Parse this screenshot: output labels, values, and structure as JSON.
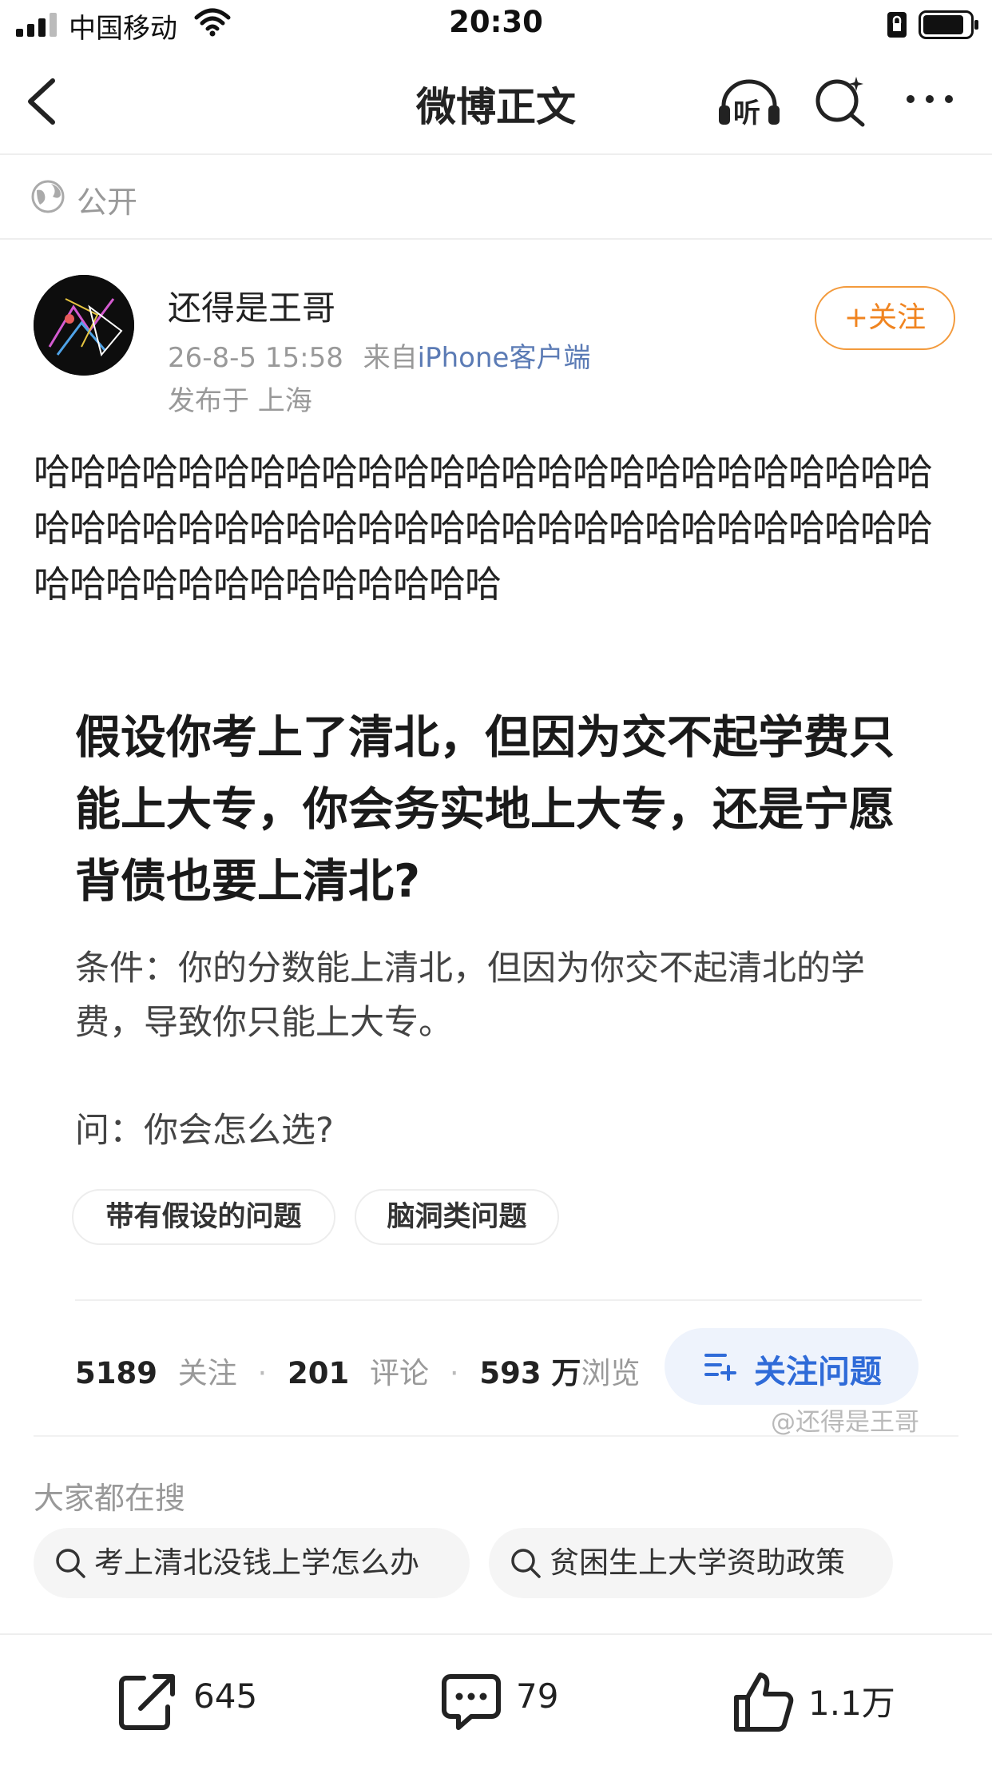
{
  "status_bar": {
    "carrier": "中国移动",
    "time": "20:30"
  },
  "nav": {
    "title": "微博正文",
    "listen_label": "听"
  },
  "visibility": {
    "label": "公开"
  },
  "post": {
    "username": "还得是王哥",
    "timestamp": "26-8-5 15:58",
    "source_prefix": "来自",
    "source": "iPhone客户端",
    "location": "发布于 上海",
    "follow_label": "+关注",
    "body": "哈哈哈哈哈哈哈哈哈哈哈哈哈哈哈哈哈哈哈哈哈哈哈哈哈哈哈哈哈哈哈哈哈哈哈哈哈哈哈哈哈哈哈哈哈哈哈哈哈哈哈哈哈哈哈哈哈哈哈哈哈哈哈"
  },
  "question": {
    "title": "假设你考上了清北，但因为交不起学费只能上大专，你会务实地上大专，还是宁愿背债也要上清北?",
    "condition": "条件：你的分数能上清北，但因为你交不起清北的学费，导致你只能上大专。",
    "ask": "问：你会怎么选?",
    "tags": [
      "带有假设的问题",
      "脑洞类问题"
    ],
    "stats": {
      "follows": "5189",
      "follows_label": "关注",
      "comments": "201",
      "comments_label": "评论",
      "views": "593 万",
      "views_label": "浏览"
    },
    "follow_question_label": "关注问题"
  },
  "watermark": "@还得是王哥",
  "search_section": {
    "title": "大家都在搜",
    "items": [
      "考上清北没钱上学怎么办",
      "贫困生上大学资助政策"
    ]
  },
  "actions": {
    "repost_count": "645",
    "comment_count": "79",
    "like_count": "1.1万"
  }
}
